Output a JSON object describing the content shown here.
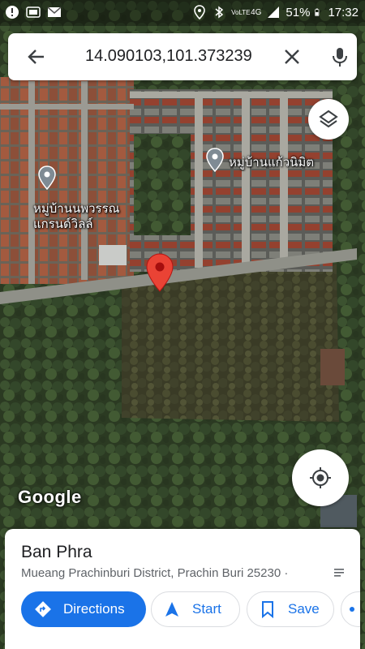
{
  "status_bar": {
    "battery": "51%",
    "time": "17:32",
    "network": "4G",
    "volte": "VoLTE",
    "icons_left": [
      "alert-icon",
      "tv-channel-icon",
      "mail-icon"
    ],
    "icons_right": [
      "location-icon",
      "bluetooth-icon",
      "signal-icon",
      "battery-icon"
    ]
  },
  "search": {
    "query": "14.090103,101.373239"
  },
  "map": {
    "labels": {
      "left_line1": "หมู่บ้านนพวรรณ",
      "left_line2": "แกรนด์วิลล์",
      "right": "หมู่บ้านแก้วนิมิต"
    },
    "attribution": "Google",
    "pin_color": "#ea4335"
  },
  "place": {
    "name": "Ban Phra",
    "address": "Mueang Prachinburi District, Prachin Buri 25230 ·"
  },
  "actions": {
    "directions": "Directions",
    "start": "Start",
    "save": "Save"
  },
  "colors": {
    "accent": "#1a73e8"
  }
}
